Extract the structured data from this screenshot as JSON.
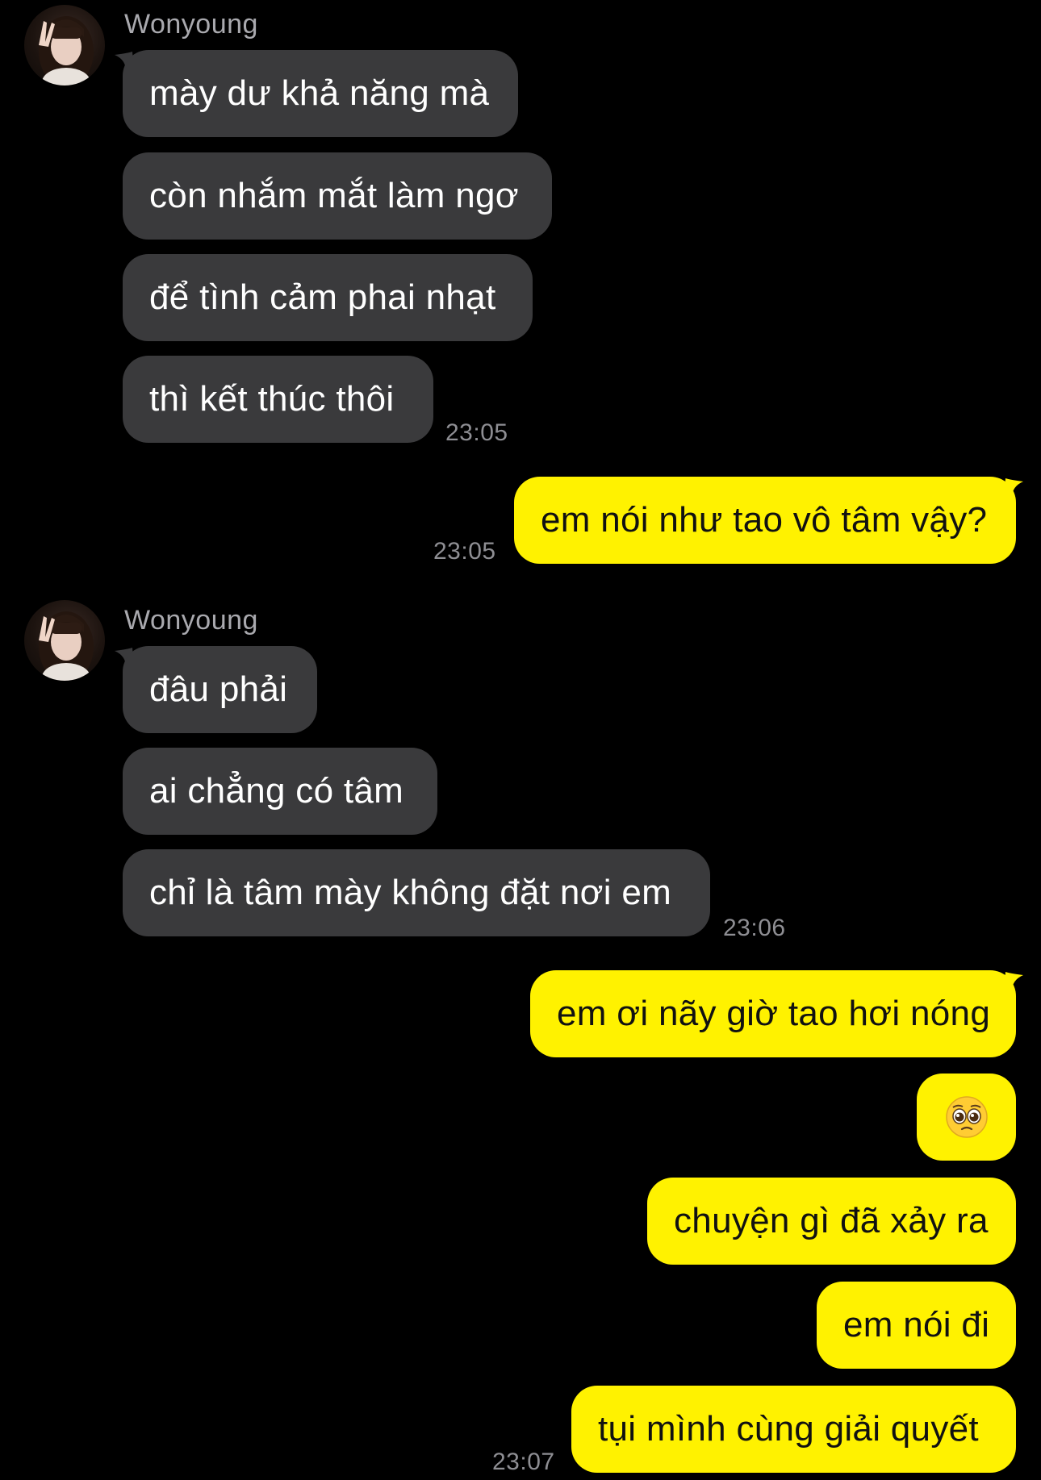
{
  "contact": {
    "name": "Wonyoung"
  },
  "colors": {
    "background": "#000000",
    "incoming_bubble": "#3a3a3c",
    "outgoing_bubble": "#fff200",
    "timestamp": "#8e8e93",
    "sender_name": "#a9a9ae"
  },
  "groups": [
    {
      "direction": "incoming",
      "sender": "Wonyoung",
      "messages": [
        "mày dư khả năng mà",
        "còn nhắm mắt làm ngơ",
        "để tình cảm phai nhạt",
        "thì kết thúc thôi"
      ],
      "time": "23:05"
    },
    {
      "direction": "outgoing",
      "messages": [
        "em nói như tao vô tâm vậy?"
      ],
      "time": "23:05"
    },
    {
      "direction": "incoming",
      "sender": "Wonyoung",
      "messages": [
        "đâu phải",
        "ai chẳng có tâm",
        "chỉ là tâm mày không đặt nơi em"
      ],
      "time": "23:06"
    },
    {
      "direction": "outgoing",
      "messages": [
        "em ơi nãy giờ tao hơi nóng",
        "chuyện gì đã xảy ra",
        "em nói đi",
        "tụi mình cùng giải quyết"
      ],
      "emoji_message": "pleading-face-emoji",
      "time": "23:07"
    }
  ]
}
